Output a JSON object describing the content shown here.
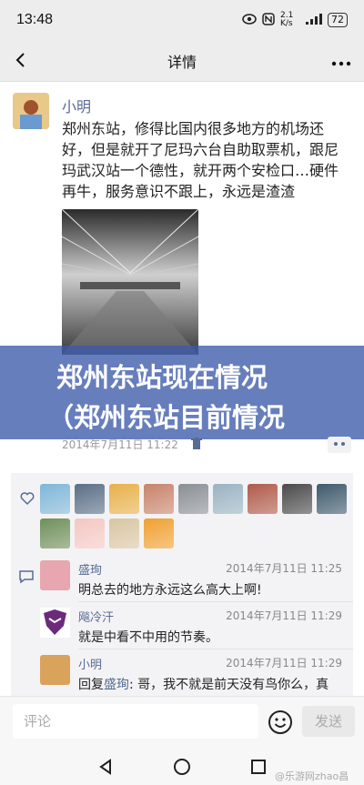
{
  "status_bar": {
    "time": "13:48",
    "net_speed": "2.1 K/s",
    "battery": "72"
  },
  "nav": {
    "title": "详情"
  },
  "post": {
    "author": "小明",
    "text": "郑州东站，修得比国内很多地方的机场还好，但是就开了尼玛六台自助取票机，跟尼玛武汉站一个德性，就开两个安检口…硬件再牛，服务意识不跟上，永远是渣渣",
    "timestamp": "2014年7月11日 11:22"
  },
  "overlay": {
    "line1": "郑州东站现在情况",
    "line2": "（郑州东站目前情况"
  },
  "likes": {
    "avatar_colors": [
      "#7fb6d8",
      "#5a6e86",
      "#e8b04a",
      "#c8836a",
      "#8a8f95",
      "#9ab3c2",
      "#b05a4a",
      "#4a4a4a",
      "#3e5a6b",
      "#6f8f5a",
      "#f4c7c3",
      "#d8c6a2",
      "#f0a030"
    ]
  },
  "comments": [
    {
      "name": "盛珣",
      "time": "2014年7月11日 11:25",
      "text": "明总去的地方永远这么高大上啊!",
      "avatar_color": "#e7a6b0"
    },
    {
      "name": "飚冷汗",
      "time": "2014年7月11日 11:29",
      "text": "就是中看不中用的节奏。",
      "avatar_color": "#6b2a7a"
    },
    {
      "name": "小明",
      "time": "2014年7月11日 11:29",
      "reply_prefix": "回复",
      "reply_to": "盛珣",
      "text": ": 哥，我不就是前天没有鸟你么，真",
      "avatar_color": "#d9a35c"
    }
  ],
  "input": {
    "placeholder": "评论",
    "send_label": "发送"
  },
  "watermark": "@乐游网zhao昌"
}
